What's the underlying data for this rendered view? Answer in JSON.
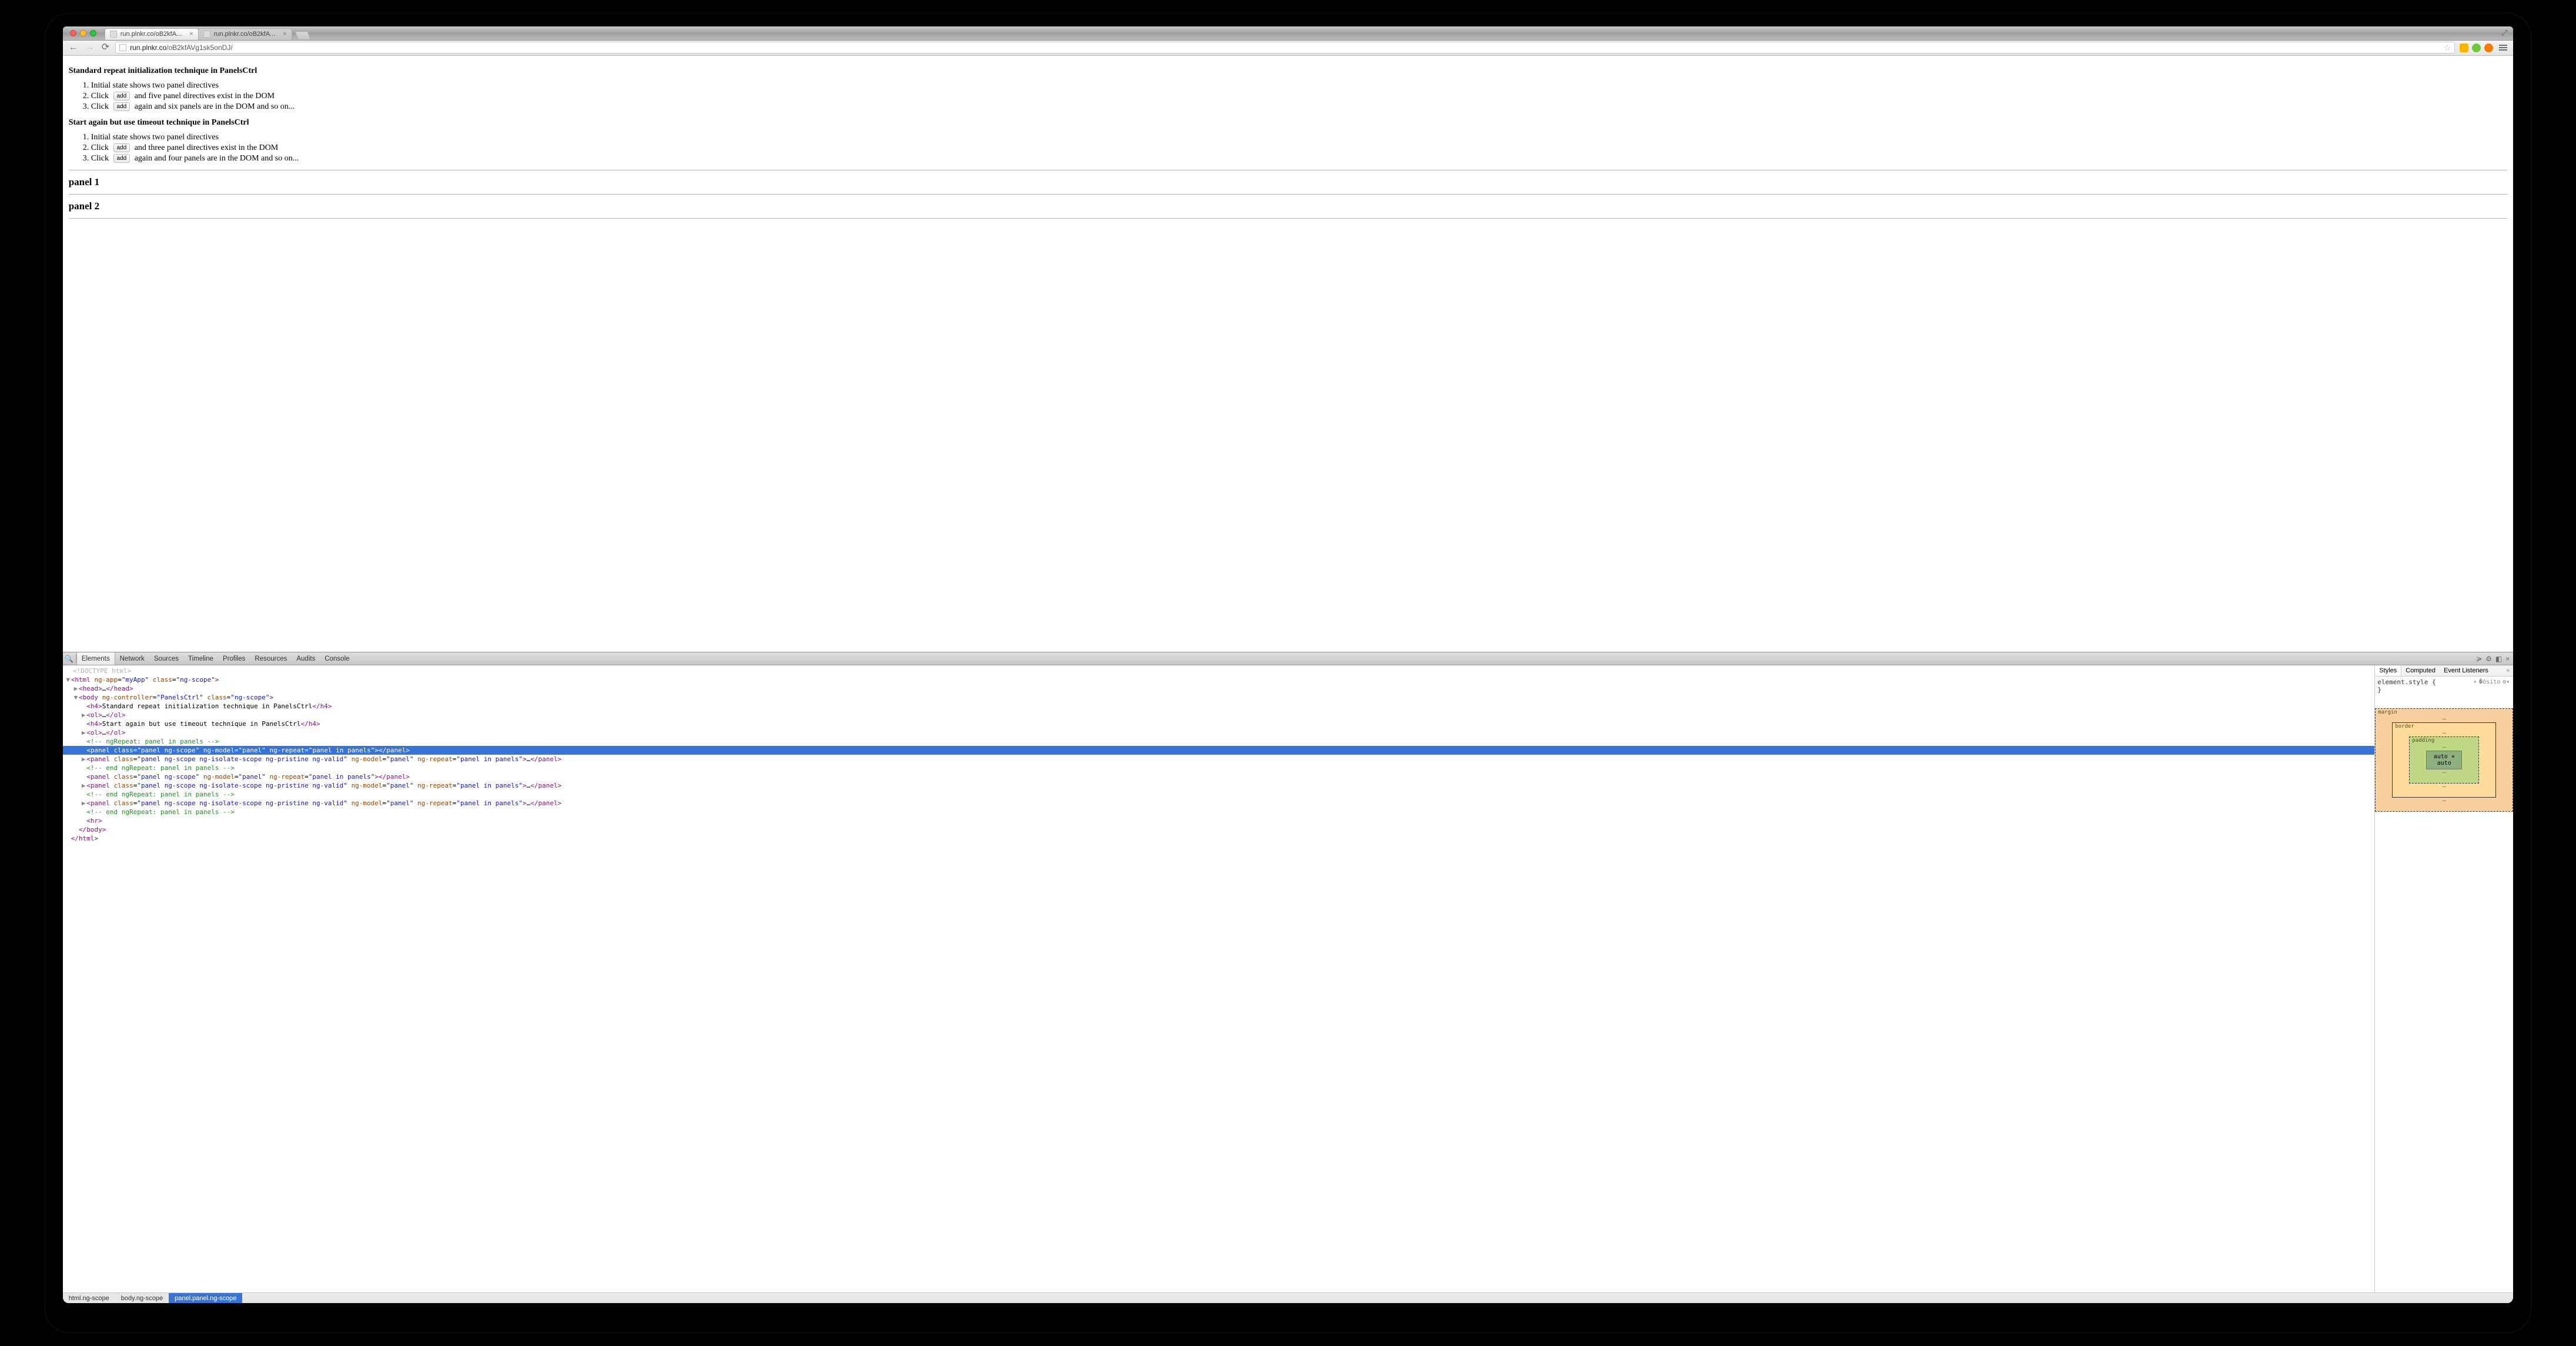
{
  "browser": {
    "tab1": "run.plnkr.co/oB2kfAVg1sk…",
    "tab2": "run.plnkr.co/oB2kfAVg1sk…",
    "url_host": "run.plnkr.co",
    "url_path": "/oB2kfAVg1sk5onDJ/"
  },
  "page": {
    "h4_1": "Standard repeat initialization technique in PanelsCtrl",
    "list1": {
      "i1": "Initial state shows two panel directives",
      "i2a": "Click",
      "i2_btn": "add",
      "i2b": "and five panel directives exist in the DOM",
      "i3a": "Click",
      "i3_btn": "add",
      "i3b": "again and six panels are in the DOM and so on..."
    },
    "h4_2": "Start again but use timeout technique in PanelsCtrl",
    "list2": {
      "i1": "Initial state shows two panel directives",
      "i2a": "Click",
      "i2_btn": "add",
      "i2b": "and three panel directives exist in the DOM",
      "i3a": "Click",
      "i3_btn": "add",
      "i3b": "again and four panels are in the DOM and so on..."
    },
    "panel1": "panel 1",
    "panel2": "panel 2"
  },
  "devtools": {
    "tabs": {
      "elements": "Elements",
      "network": "Network",
      "sources": "Sources",
      "timeline": "Timeline",
      "profiles": "Profiles",
      "resources": "Resources",
      "audits": "Audits",
      "console": "Console"
    },
    "elements_src": {
      "l0": "<!DOCTYPE html>",
      "l1_open": "<html ",
      "l1_a1n": "ng-app",
      "l1_a1v": "\"myApp\"",
      "l1_a2n": "class",
      "l1_a2v": "\"ng-scope\"",
      "l1_close": ">",
      "l2": "<head>…</head>",
      "l3_open": "<body ",
      "l3_a1n": "ng-controller",
      "l3_a1v": "\"PanelsCtrl\"",
      "l3_a2n": "class",
      "l3_a2v": "\"ng-scope\"",
      "l3_close": ">",
      "l4": "<h4>Standard repeat initialization technique in PanelsCtrl</h4>",
      "l5": "<ol>…</ol>",
      "l6": "<h4>Start again but use timeout technique in PanelsCtrl</h4>",
      "l7": "<ol>…</ol>",
      "l8": "<!-- ngRepeat: panel in panels -->",
      "l9": "<panel class=\"panel ng-scope\" ng-model=\"panel\" ng-repeat=\"panel in panels\"></panel>",
      "l10": "<panel class=\"panel ng-scope ng-isolate-scope ng-pristine ng-valid\" ng-model=\"panel\" ng-repeat=\"panel in panels\">…</panel>",
      "l11": "<!-- end ngRepeat: panel in panels -->",
      "l12": "<panel class=\"panel ng-scope\" ng-model=\"panel\" ng-repeat=\"panel in panels\"></panel>",
      "l13": "<panel class=\"panel ng-scope ng-isolate-scope ng-pristine ng-valid\" ng-model=\"panel\" ng-repeat=\"panel in panels\">…</panel>",
      "l14": "<!-- end ngRepeat: panel in panels -->",
      "l15": "<panel class=\"panel ng-scope ng-isolate-scope ng-pristine ng-valid\" ng-model=\"panel\" ng-repeat=\"panel in panels\">…</panel>",
      "l16": "<!-- end ngRepeat: panel in panels -->",
      "l17": "<hr>",
      "l18": "</body>",
      "l19": "</html>"
    },
    "styles": {
      "tab_styles": "Styles",
      "tab_computed": "Computed",
      "tab_eventlisteners": "Event Listeners",
      "rule": "element.style {",
      "rule_close": "}",
      "bm_margin": "margin",
      "bm_border": "border",
      "bm_padding": "padding",
      "bm_content": "auto × auto",
      "bm_dash": "–"
    },
    "crumbs": {
      "c1": "html.ng-scope",
      "c2": "body.ng-scope",
      "c3": "panel.panel.ng-scope"
    }
  }
}
